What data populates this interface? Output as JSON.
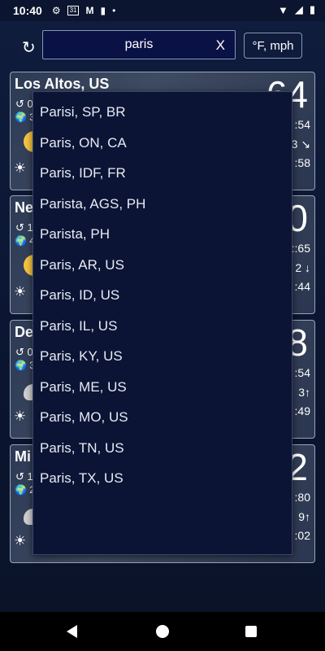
{
  "status_bar": {
    "time": "10:40",
    "left_icons": [
      "gear-icon",
      "calendar-icon",
      "gmail-icon",
      "sd-card-icon",
      "dot-icon"
    ],
    "calendar_day": "31",
    "right_icons": [
      "wifi-icon",
      "signal-icon",
      "battery-icon"
    ]
  },
  "toolbar": {
    "search_value": "paris",
    "clear_label": "X",
    "units_label": "°F, mph"
  },
  "cards": [
    {
      "city": "Los Altos, US",
      "sub1": "↺ 0",
      "sub2": "🌍 3",
      "temp": "64",
      "r1": ":54",
      "r2": "3 ↘",
      "r3": ":58",
      "icon": "sun"
    },
    {
      "city": "Ne",
      "sub1": "↺ 1",
      "sub2": "🌍 4",
      "temp": "0",
      "r1": "::65",
      "r2": "2 ↓",
      "r3": ":44",
      "icon": "sun"
    },
    {
      "city": "De",
      "sub1": "↺ 0",
      "sub2": "🌍 3",
      "temp": "8",
      "r1": ":54",
      "r2": "3↑",
      "r3": ":49",
      "icon": "cloud"
    },
    {
      "city": "Mi",
      "sub1": "↺ 1",
      "sub2": "🌍 2",
      "temp": "2",
      "r1": ":80",
      "r2": "9↑",
      "r3": ":02",
      "icon": "cloud"
    }
  ],
  "dropdown": {
    "items": [
      "Parisi, SP, BR",
      "Paris, ON, CA",
      "Paris, IDF, FR",
      "Parista, AGS, PH",
      "Parista, PH",
      "Paris, AR, US",
      "Paris, ID, US",
      "Paris, IL, US",
      "Paris, KY, US",
      "Paris, ME, US",
      "Paris, MO, US",
      "Paris, TN, US",
      "Paris, TX, US"
    ]
  }
}
